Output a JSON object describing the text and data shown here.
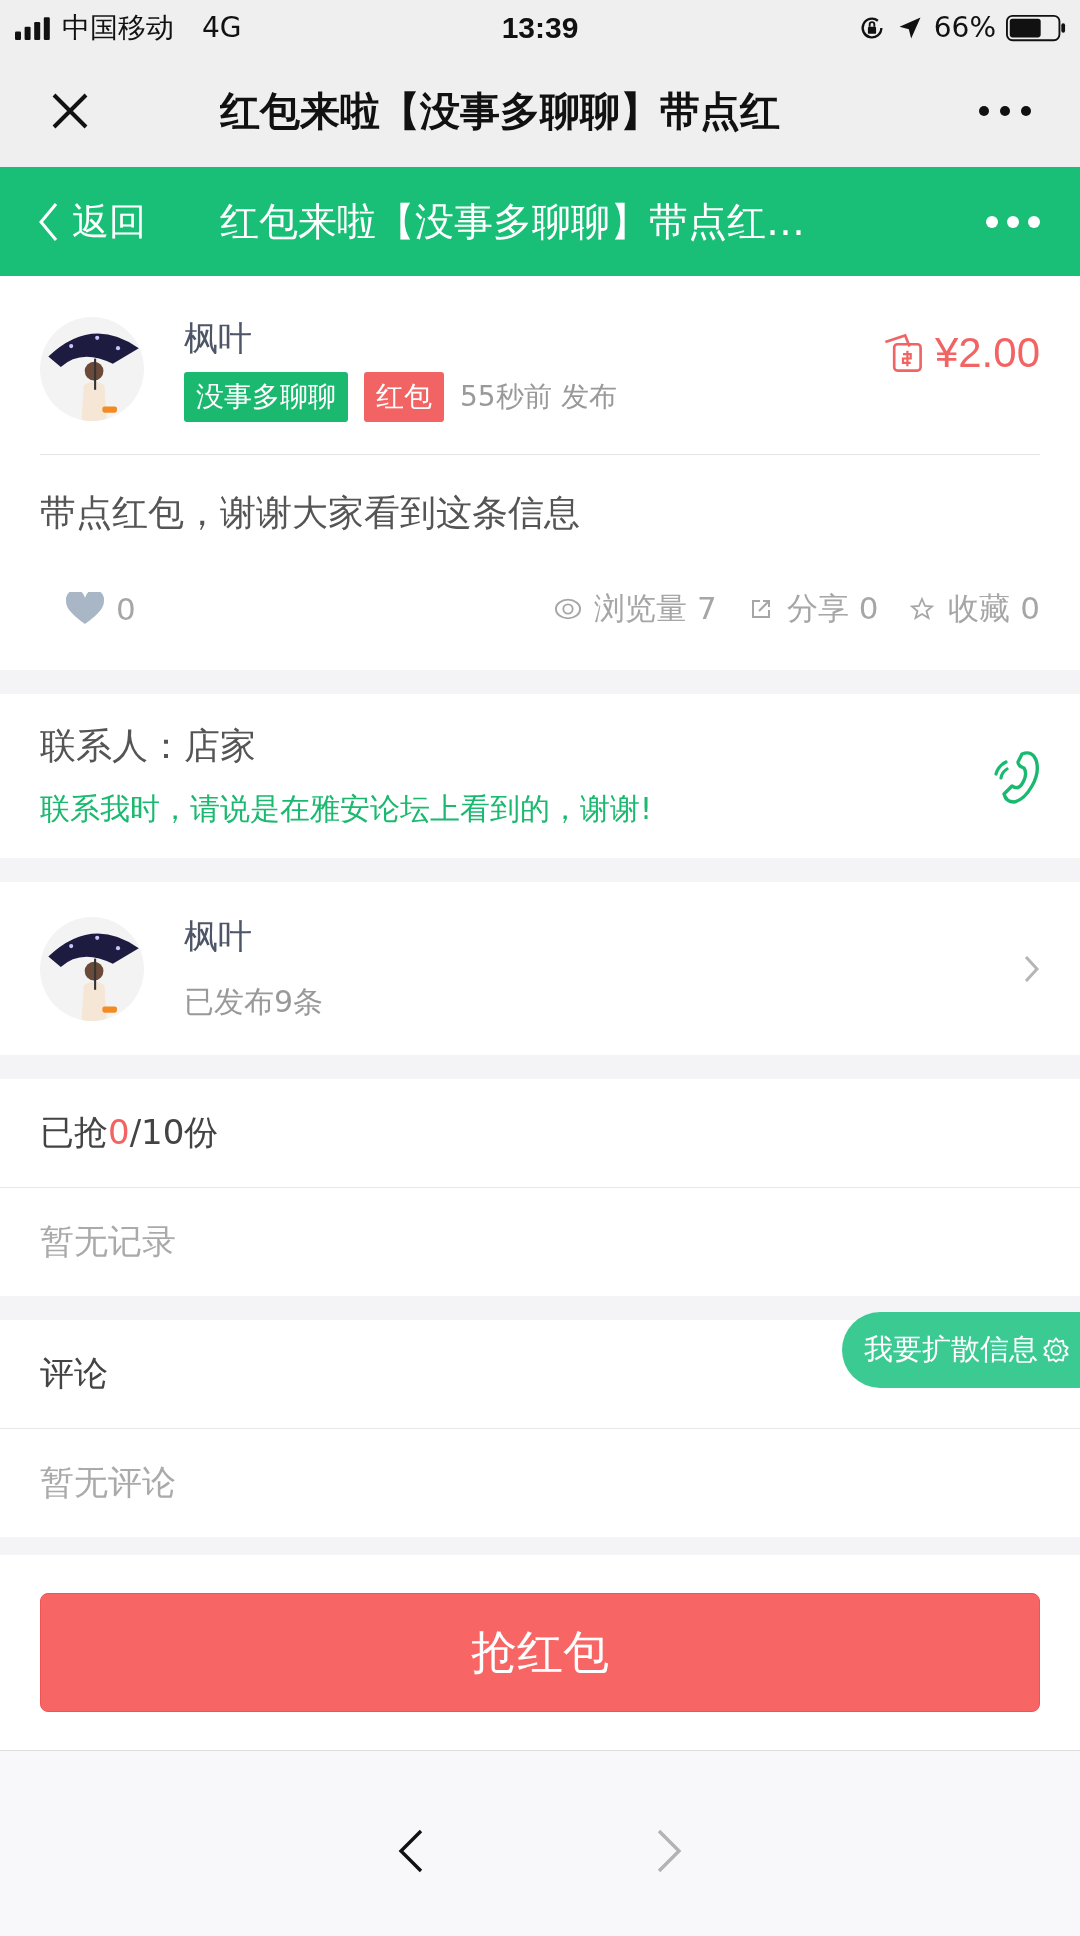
{
  "status_bar": {
    "carrier": "中国移动",
    "network": "4G",
    "time": "13:39",
    "battery": "66%"
  },
  "wechat_bar": {
    "title": "红包来啦【没事多聊聊】带点红"
  },
  "header": {
    "back": "返回",
    "title": "红包来啦【没事多聊聊】带点红…"
  },
  "post": {
    "author": "枫叶",
    "tags": [
      {
        "label": "没事多聊聊",
        "color": "#1bb96f"
      },
      {
        "label": "红包",
        "color": "#f26464"
      }
    ],
    "time": "55秒前 发布",
    "amount": "¥2.00",
    "body": "带点红包，谢谢大家看到这条信息",
    "likes": "0",
    "stats": [
      {
        "kind": "views",
        "label": "浏览量 7"
      },
      {
        "kind": "share",
        "label": "分享 0"
      },
      {
        "kind": "favorite",
        "label": "收藏 0"
      }
    ]
  },
  "contact": {
    "label": "联系人：店家",
    "note": "联系我时，请说是在雅安论坛上看到的，谢谢!"
  },
  "publisher": {
    "name": "枫叶",
    "count": "已发布9条"
  },
  "grabbed": {
    "prefix": "已抢",
    "count": "0",
    "suffix": "/10份",
    "empty": "暂无记录"
  },
  "comments": {
    "title": "评论",
    "empty": "暂无评论"
  },
  "float_button": {
    "label": "我要扩散信息"
  },
  "grab_button": {
    "label": "抢红包"
  }
}
